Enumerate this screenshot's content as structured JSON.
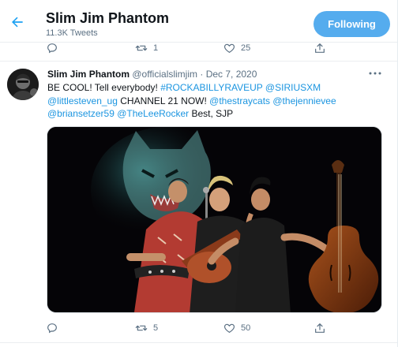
{
  "header": {
    "title": "Slim Jim Phantom",
    "tweet_count": "11.3K Tweets",
    "follow_label": "Following"
  },
  "prev_tweet": {
    "reply_count": "",
    "retweet_count": "1",
    "like_count": "25"
  },
  "tweet": {
    "name": "Slim Jim Phantom",
    "handle": "@officialslimjim",
    "separator": " · ",
    "date": "Dec 7, 2020",
    "text": {
      "t1": "BE COOL! Tell everybody! ",
      "l1": "#ROCKABILLYRAVEUP",
      "t2": " ",
      "l2": "@SIRIUSXM",
      "t3": " ",
      "l3": "@littlesteven_ug",
      "t4": " CHANNEL 21 NOW! ",
      "l4": "@thestraycats",
      "t5": " ",
      "l5": "@thejennievee",
      "t6": " ",
      "l6": "@briansetzer59",
      "t7": " ",
      "l7": "@TheLeeRocker",
      "t8": " Best,  SJP"
    },
    "reply_count": "",
    "retweet_count": "5",
    "like_count": "50"
  },
  "colors": {
    "accent": "#1da1f2",
    "follow_bg": "#55acee",
    "link": "#1b95e0",
    "muted": "#5b7083"
  },
  "icons": {
    "back": "arrow-left-icon",
    "reply": "reply-icon",
    "retweet": "retweet-icon",
    "like": "heart-icon",
    "share": "share-icon",
    "more": "more-icon"
  }
}
